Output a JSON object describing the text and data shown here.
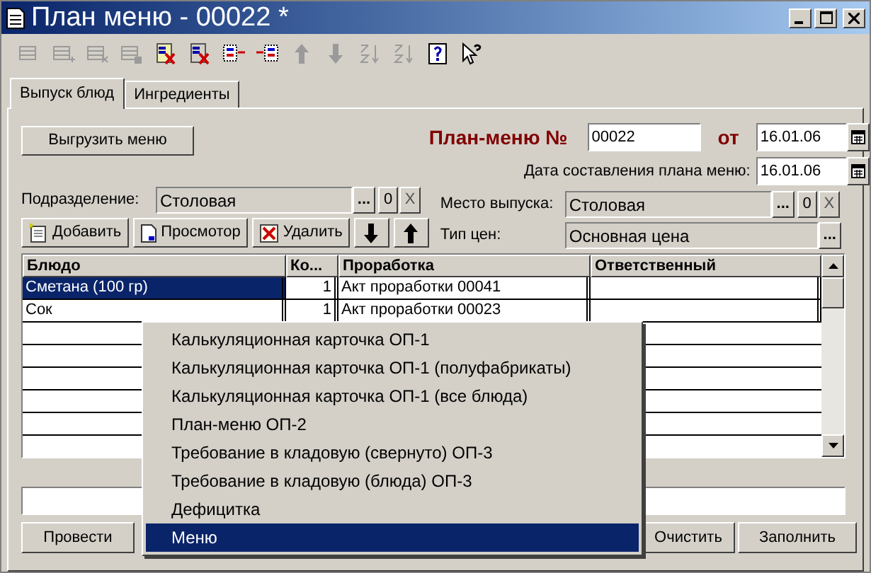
{
  "window": {
    "title": "План меню - 00022 *"
  },
  "toolbar": [
    {
      "kind": "grid",
      "disabled": true
    },
    {
      "kind": "grid-add",
      "disabled": true
    },
    {
      "kind": "grid-delete",
      "disabled": true
    },
    {
      "kind": "grid-save",
      "disabled": true
    },
    {
      "kind": "report-delete",
      "disabled": false
    },
    {
      "kind": "report",
      "disabled": false
    },
    {
      "kind": "list-in",
      "disabled": false
    },
    {
      "kind": "list-out",
      "disabled": false
    },
    {
      "kind": "arrow-up",
      "disabled": true
    },
    {
      "kind": "arrow-down",
      "disabled": true
    },
    {
      "kind": "sort-asc",
      "disabled": true
    },
    {
      "kind": "sort-desc",
      "disabled": true
    },
    {
      "kind": "help",
      "disabled": false
    },
    {
      "kind": "pointer-help",
      "disabled": false
    }
  ],
  "tabs": [
    {
      "label": "Выпуск блюд",
      "selected": true
    },
    {
      "label": "Ингредиенты",
      "selected": false
    }
  ],
  "export_button": "Выгрузить меню",
  "header": {
    "label": "План-меню №",
    "number": "00022",
    "date_prefix": "от",
    "date": "16.01.06",
    "compiled_label": "Дата составления плана меню:",
    "compiled_date": "16.01.06"
  },
  "division": {
    "label": "Подразделение:",
    "value": "Столовая",
    "select": "...",
    "clear": "0",
    "remove": "X"
  },
  "place": {
    "label": "Место выпуска:",
    "value": "Столовая",
    "select": "...",
    "clear": "0",
    "remove": "X"
  },
  "price_type": {
    "label": "Тип цен:",
    "value": "Основная цена",
    "select": "..."
  },
  "actions": [
    {
      "kind": "add",
      "label": "Добавить"
    },
    {
      "kind": "view",
      "label": "Просмотор"
    },
    {
      "kind": "delete",
      "label": "Удалить"
    },
    {
      "kind": "down"
    },
    {
      "kind": "up"
    }
  ],
  "table": {
    "columns": [
      "Блюдо",
      "Ко...",
      "Проработка",
      "Ответственный"
    ],
    "rows": [
      {
        "cells": [
          "Сметана (100 гр)",
          "1",
          "Акт проработки 00041",
          ""
        ],
        "selected": true
      },
      {
        "cells": [
          "Сок",
          "1",
          "Акт проработки 00023",
          ""
        ],
        "selected": false
      }
    ]
  },
  "buttons": [
    "Провести",
    "Очистить",
    "Заполнить"
  ],
  "context_menu": [
    {
      "label": "Калькуляционная карточка ОП-1",
      "selected": false
    },
    {
      "label": "Калькуляционная карточка ОП-1 (полуфабрикаты)",
      "selected": false
    },
    {
      "label": "Калькуляционная карточка ОП-1 (все блюда)",
      "selected": false
    },
    {
      "label": "План-меню ОП-2",
      "selected": false
    },
    {
      "label": "Требование в кладовую (свернуто) ОП-3",
      "selected": false
    },
    {
      "label": "Требование в кладовую (блюда) ОП-3",
      "selected": false
    },
    {
      "label": "Дефицитка",
      "selected": false
    },
    {
      "label": "Меню",
      "selected": true
    }
  ]
}
